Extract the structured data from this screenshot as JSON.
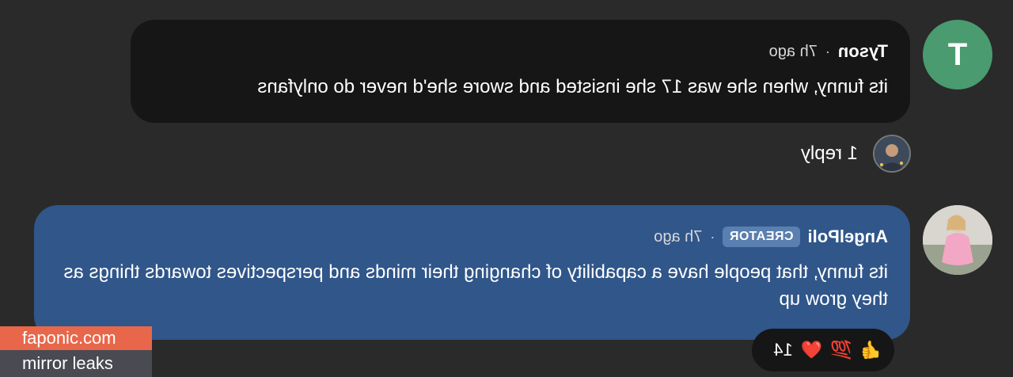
{
  "comments": [
    {
      "author": "Tyson",
      "avatar_letter": "T",
      "time": "7h ago",
      "text": "its funny, when she was 17 she insisted and swore she'd never do onlyfans",
      "avatar_color": "#4a9b6f"
    },
    {
      "author": "AngelPoli",
      "badge": "CREATOR",
      "time": "7h ago",
      "text": "its funny, that people have a capability of changing their minds and perspectives towards things as they grow up",
      "bubble_color": "#30568a"
    }
  ],
  "replies": {
    "label": "1 reply"
  },
  "reactions": {
    "emojis": [
      "👍",
      "💯",
      "❤️"
    ],
    "count": "14"
  },
  "watermark": {
    "line1": "faponic.com",
    "line2": "mirror leaks"
  },
  "icons": {
    "reply_avatar": "user-photo-icon",
    "creator_avatar": "user-photo-icon"
  }
}
